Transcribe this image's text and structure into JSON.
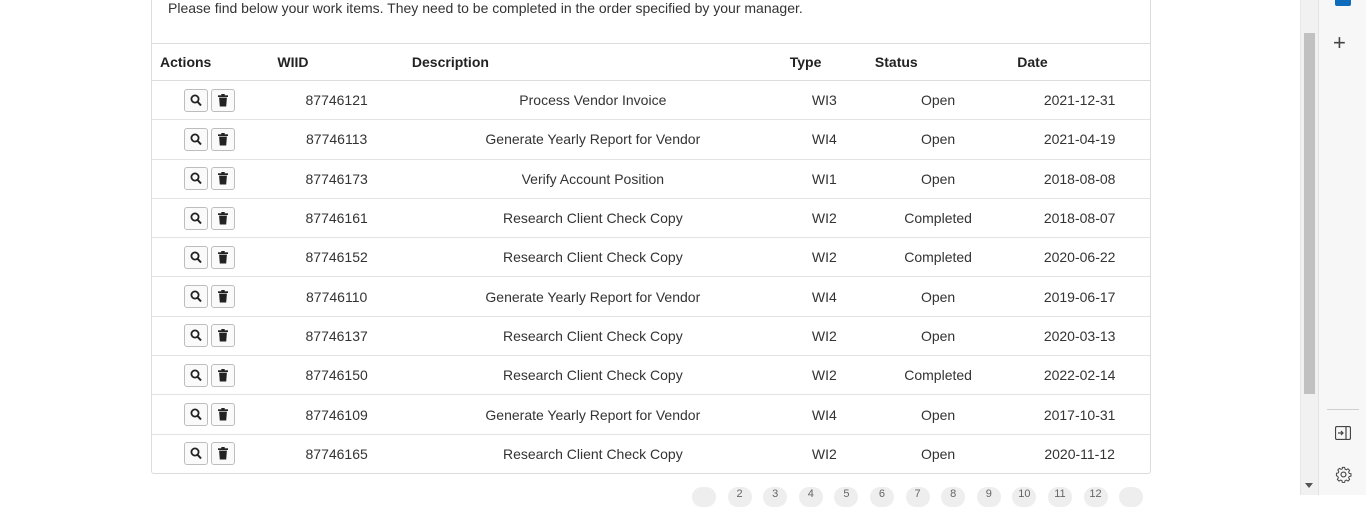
{
  "intro_text": "Please find below your work items. They need to be completed in the order specified by your manager.",
  "table": {
    "headers": {
      "actions": "Actions",
      "wiid": "WIID",
      "description": "Description",
      "type": "Type",
      "status": "Status",
      "date": "Date"
    },
    "rows": [
      {
        "wiid": "87746121",
        "description": "Process Vendor Invoice",
        "type": "WI3",
        "status": "Open",
        "date": "2021-12-31"
      },
      {
        "wiid": "87746113",
        "description": "Generate Yearly Report for Vendor",
        "type": "WI4",
        "status": "Open",
        "date": "2021-04-19"
      },
      {
        "wiid": "87746173",
        "description": "Verify Account Position",
        "type": "WI1",
        "status": "Open",
        "date": "2018-08-08"
      },
      {
        "wiid": "87746161",
        "description": "Research Client Check Copy",
        "type": "WI2",
        "status": "Completed",
        "date": "2018-08-07"
      },
      {
        "wiid": "87746152",
        "description": "Research Client Check Copy",
        "type": "WI2",
        "status": "Completed",
        "date": "2020-06-22"
      },
      {
        "wiid": "87746110",
        "description": "Generate Yearly Report for Vendor",
        "type": "WI4",
        "status": "Open",
        "date": "2019-06-17"
      },
      {
        "wiid": "87746137",
        "description": "Research Client Check Copy",
        "type": "WI2",
        "status": "Open",
        "date": "2020-03-13"
      },
      {
        "wiid": "87746150",
        "description": "Research Client Check Copy",
        "type": "WI2",
        "status": "Completed",
        "date": "2022-02-14"
      },
      {
        "wiid": "87746109",
        "description": "Generate Yearly Report for Vendor",
        "type": "WI4",
        "status": "Open",
        "date": "2017-10-31"
      },
      {
        "wiid": "87746165",
        "description": "Research Client Check Copy",
        "type": "WI2",
        "status": "Open",
        "date": "2020-11-12"
      }
    ],
    "row_icons": [
      "search-icon",
      "trash-icon"
    ]
  },
  "pagination": {
    "pages": [
      "",
      "2",
      "3",
      "4",
      "5",
      "6",
      "7",
      "8",
      "9",
      "10",
      "11",
      "12",
      ""
    ]
  },
  "sidebar_icons": [
    "outlook-icon",
    "plus-icon",
    "split-screen-icon",
    "gear-icon"
  ],
  "colors": {
    "brand": "#0f6cbd",
    "border": "#dcdcdc",
    "scroll_thumb": "#c1c1c1"
  }
}
